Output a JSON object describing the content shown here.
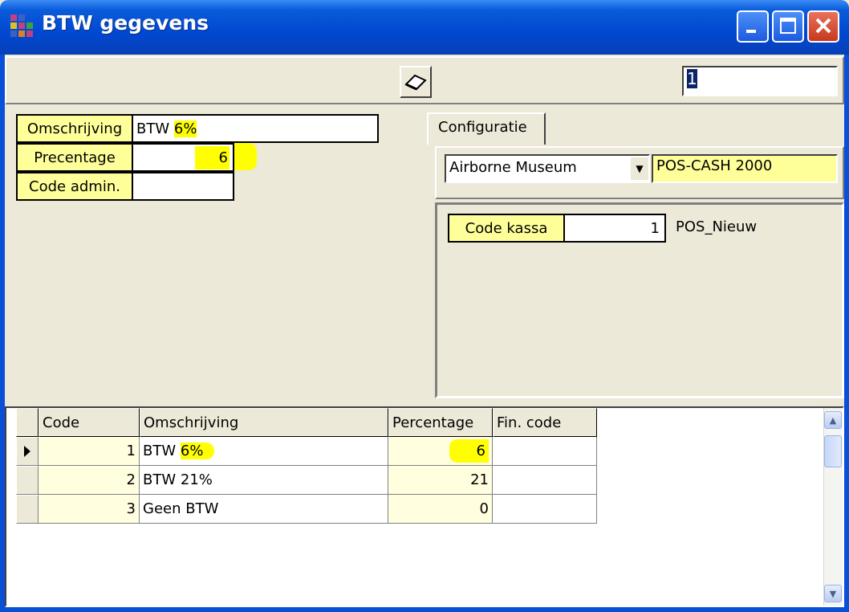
{
  "window": {
    "title": "BTW gegevens"
  },
  "toolbar": {
    "record_number": "1"
  },
  "form": {
    "omschrijving_label": "Omschrijving",
    "omschrijving_value_prefix": "BTW ",
    "omschrijving_value_hl": "6%",
    "percentage_label": "Precentage",
    "percentage_value": "6",
    "code_admin_label": "Code admin.",
    "code_admin_value": ""
  },
  "config": {
    "tab_label": "Configuratie",
    "location_select": "Airborne Museum",
    "system_name": "POS-CASH 2000",
    "code_kassa_label": "Code kassa",
    "code_kassa_value": "1",
    "kassa_name": "POS_Nieuw"
  },
  "grid": {
    "headers": [
      "Code",
      "Omschrijving",
      "Percentage",
      "Fin. code"
    ],
    "rows": [
      {
        "code": "1",
        "omschrijving": "BTW ",
        "omschrijving_hl": "6%",
        "percentage": "6",
        "fin_code": ""
      },
      {
        "code": "2",
        "omschrijving": "BTW 21%",
        "omschrijving_hl": "",
        "percentage": "21",
        "fin_code": ""
      },
      {
        "code": "3",
        "omschrijving": "Geen BTW",
        "omschrijving_hl": "",
        "percentage": "0",
        "fin_code": ""
      }
    ]
  },
  "colors": {
    "titlebar": "#0048D0",
    "label_bg": "#FFFF99",
    "highlight": "#FFFF00",
    "grid_cell": "#FFFFE0"
  },
  "icons": [
    "app-icon",
    "minimize-icon",
    "maximize-icon",
    "close-icon",
    "eraser-icon",
    "row-indicator-icon",
    "scroll-up-icon",
    "scroll-down-icon"
  ]
}
